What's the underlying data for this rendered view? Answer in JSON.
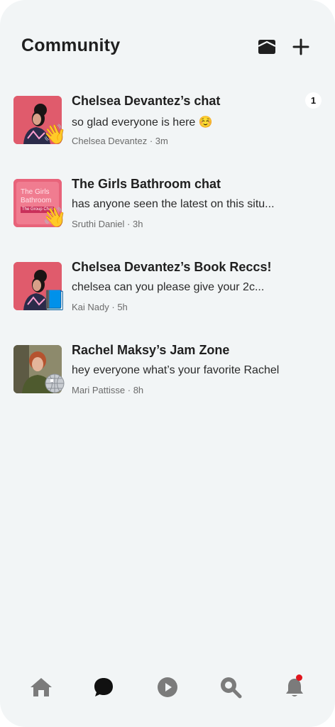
{
  "header": {
    "title": "Community"
  },
  "chats": [
    {
      "title": "Chelsea Devantez’s chat",
      "message": "so glad everyone is here ☺️",
      "author": "Chelsea Devantez",
      "time": "3m",
      "badge_emoji": "👋",
      "unread": "1",
      "avatar": "woman-portrait-pink"
    },
    {
      "title": "The Girls Bathroom chat",
      "message": "has anyone seen the latest on this situ...",
      "author": "Sruthi Daniel",
      "time": "3h",
      "badge_emoji": "👋",
      "unread": "",
      "avatar": "podcast-cover-pink",
      "avatar_text": [
        "The Girls",
        "Bathroom",
        "The Group Chat"
      ]
    },
    {
      "title": "Chelsea Devantez’s Book Reccs!",
      "message": "chelsea can you please give your 2c...",
      "author": "Kai Nady",
      "time": "5h",
      "badge_emoji": "📘",
      "unread": "",
      "avatar": "woman-portrait-pink"
    },
    {
      "title": "Rachel Maksy’s Jam Zone",
      "message": "hey everyone what’s your favorite Rachel",
      "author": "Mari Pattisse",
      "time": "8h",
      "badge_emoji": "🪩",
      "unread": "",
      "avatar": "woman-portrait-green"
    }
  ],
  "tabs": [
    {
      "name": "home",
      "icon": "home-icon",
      "active": false
    },
    {
      "name": "chat",
      "icon": "chat-bubble-icon",
      "active": true
    },
    {
      "name": "play",
      "icon": "play-icon",
      "active": false
    },
    {
      "name": "search",
      "icon": "search-icon",
      "active": false
    },
    {
      "name": "notifications",
      "icon": "bell-icon",
      "active": false,
      "has_dot": true
    }
  ],
  "colors": {
    "background": "#f2f5f6",
    "text": "#1f1f1f",
    "muted": "#6b6b6b",
    "tab_inactive": "#7b7b7b",
    "tab_active": "#111111",
    "notification_dot": "#e0151d"
  }
}
